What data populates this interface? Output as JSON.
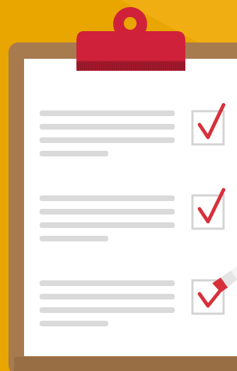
{
  "scene": {
    "description_icon": "clipboard-checklist-illustration",
    "colors": {
      "background": "#E9A500",
      "background_highlight": "#F3B21A",
      "board": "#A87B4E",
      "board_shadow": "#8E653E",
      "paper": "#FFFFFF",
      "line": "#DADADA",
      "checkbox_border": "#D3D3D3",
      "check": "#D7303B",
      "clip": "#D0213A",
      "clip_dark": "#A81A2E",
      "pen_body": "#EFEFEF",
      "pen_tip": "#D7303B"
    },
    "checklist": {
      "items": [
        {
          "checked": true
        },
        {
          "checked": true
        },
        {
          "checked": true
        }
      ]
    }
  }
}
